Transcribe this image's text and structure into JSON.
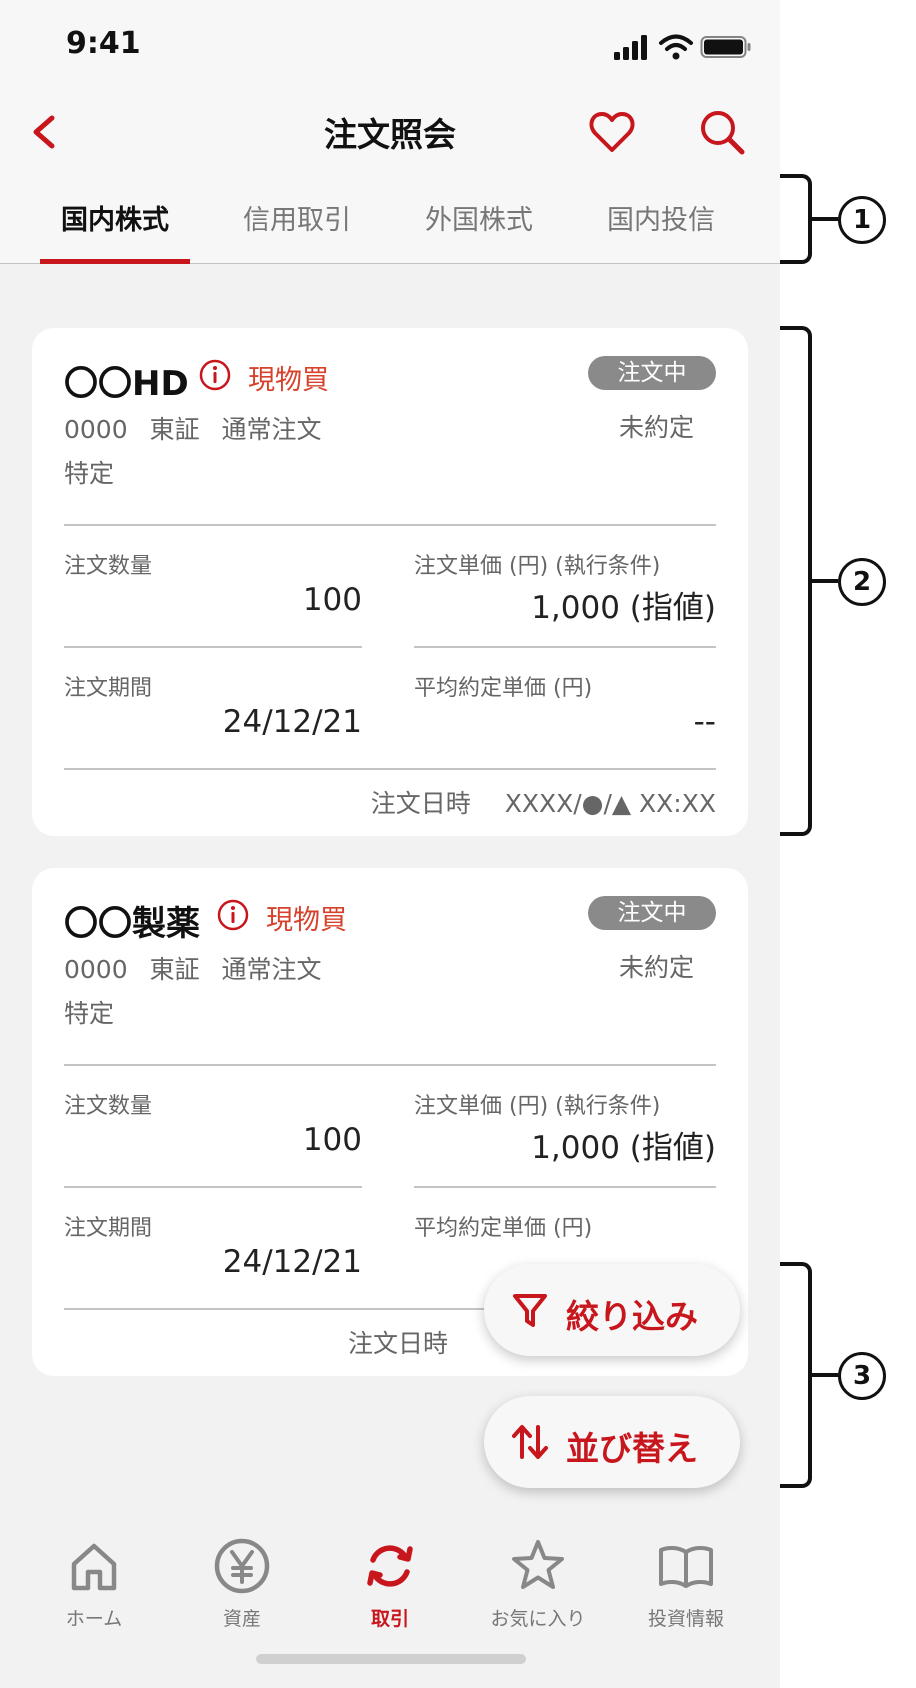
{
  "status_bar": {
    "time": "9:41"
  },
  "header": {
    "title": "注文照会",
    "back_icon": "chevron-left-icon",
    "favorite_icon": "heart-icon",
    "search_icon": "search-icon"
  },
  "tabs": [
    {
      "label": "国内株式",
      "active": true
    },
    {
      "label": "信用取引",
      "active": false
    },
    {
      "label": "外国株式",
      "active": false
    },
    {
      "label": "国内投信",
      "active": false
    }
  ],
  "orders": [
    {
      "name": "〇〇HD",
      "trade_type": "現物買",
      "status_badge": "注文中",
      "code": "0000",
      "market": "東証",
      "order_kind": "通常注文",
      "account": "特定",
      "execution_status": "未約定",
      "qty_label": "注文数量",
      "qty_value": "100",
      "price_label": "注文単価 (円) (執行条件)",
      "price_value": "1,000 (指値)",
      "period_label": "注文期間",
      "period_value": "24/12/21",
      "avg_label": "平均約定単価 (円)",
      "avg_value": "--",
      "datetime_label": "注文日時",
      "datetime_value": "XXXX/●/▲ XX:XX"
    },
    {
      "name": "〇〇製薬",
      "trade_type": "現物買",
      "status_badge": "注文中",
      "code": "0000",
      "market": "東証",
      "order_kind": "通常注文",
      "account": "特定",
      "execution_status": "未約定",
      "qty_label": "注文数量",
      "qty_value": "100",
      "price_label": "注文単価 (円) (執行条件)",
      "price_value": "1,000 (指値)",
      "period_label": "注文期間",
      "period_value": "24/12/21",
      "avg_label": "平均約定単価 (円)",
      "datetime_label": "注文日時"
    }
  ],
  "fabs": {
    "filter_label": "絞り込み",
    "sort_label": "並び替え"
  },
  "bottom_nav": [
    {
      "label": "ホーム",
      "icon": "home-icon",
      "active": false
    },
    {
      "label": "資産",
      "icon": "yen-icon",
      "active": false
    },
    {
      "label": "取引",
      "icon": "refresh-icon",
      "active": true
    },
    {
      "label": "お気に入り",
      "icon": "star-icon",
      "active": false
    },
    {
      "label": "投資情報",
      "icon": "book-icon",
      "active": false
    }
  ],
  "annotations": [
    "1",
    "2",
    "3"
  ],
  "colors": {
    "accent": "#c8161d",
    "trade_type": "#d6422b",
    "badge": "#8a8a8a",
    "background": "#f2f2f2"
  }
}
